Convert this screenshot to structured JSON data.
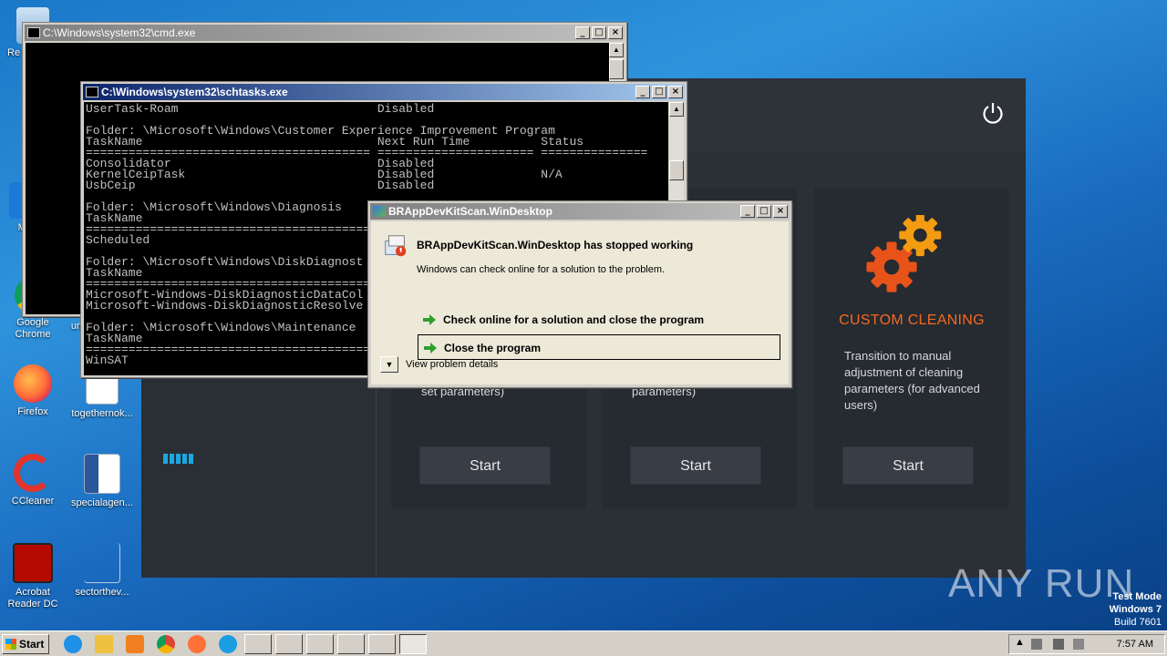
{
  "desktop": {
    "icons": [
      {
        "label": "Re"
      },
      {
        "label": "Micr"
      },
      {
        "label": "Google Chrome"
      },
      {
        "label": "Firefox"
      },
      {
        "label": "togethernok..."
      },
      {
        "label": "CCleaner"
      },
      {
        "label": "specialagen..."
      },
      {
        "label": "Acrobat Reader DC"
      },
      {
        "label": "sectorthev..."
      },
      {
        "label": "un"
      }
    ]
  },
  "app": {
    "cards": [
      {
        "desc": "set parameters)",
        "start": "Start"
      },
      {
        "desc": "parameters)",
        "start": "Start"
      },
      {
        "title": "CUSTOM CLEANING",
        "desc": "Transition to manual adjustment of cleaning parameters (for advanced users)",
        "start": "Start"
      }
    ]
  },
  "cmd": {
    "title": "C:\\Windows\\system32\\cmd.exe"
  },
  "schtasks": {
    "title": "C:\\Windows\\system32\\schtasks.exe",
    "console": "UserTask-Roam                            Disabled\n\nFolder: \\Microsoft\\Windows\\Customer Experience Improvement Program\nTaskName                                 Next Run Time          Status\n======================================== ====================== ===============\nConsolidator                             Disabled\nKernelCeipTask                           Disabled               N/A\nUsbCeip                                  Disabled\n\nFolder: \\Microsoft\\Windows\\Diagnosis\nTaskName\n========================================\nScheduled\n\nFolder: \\Microsoft\\Windows\\DiskDiagnost\nTaskName\n========================================\nMicrosoft-Windows-DiskDiagnosticDataCol\nMicrosoft-Windows-DiskDiagnosticResolve\n\nFolder: \\Microsoft\\Windows\\Maintenance\nTaskName\n========================================\nWinSAT"
  },
  "dialog": {
    "title": "BRAppDevKitScan.WinDesktop",
    "heading": "BRAppDevKitScan.WinDesktop has stopped working",
    "sub": "Windows can check online for a solution to the problem.",
    "option1": "Check online for a solution and close the program",
    "option2": "Close the program",
    "details": "View problem details"
  },
  "taskbar": {
    "start": "Start",
    "clock": "7:57 AM"
  },
  "watermark": "ANY RUN",
  "testmode": {
    "line1": "Test Mode",
    "line2": "Windows 7",
    "line3": "Build 7601"
  },
  "colors": {
    "accent_orange": "#f26a21",
    "gear_orange": "#f39c12",
    "titlebar_active": "#0a246a",
    "titlebar_inactive": "#808080"
  }
}
